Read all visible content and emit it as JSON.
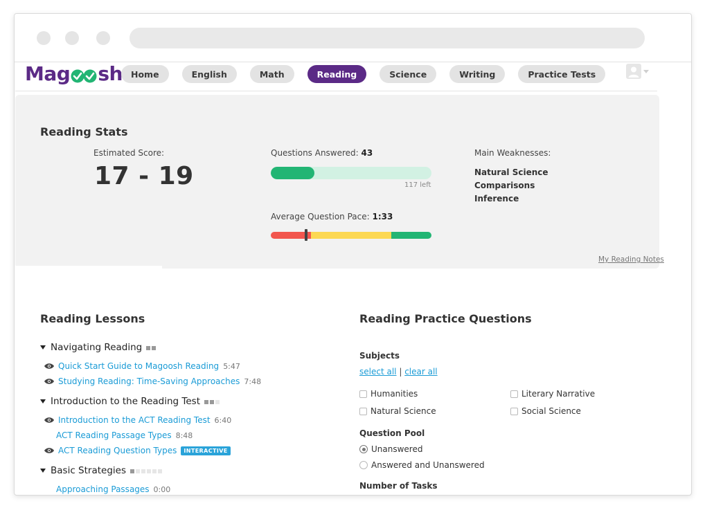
{
  "brand": {
    "logo_left": "Mag",
    "logo_right": "sh",
    "color_brand": "#5b2a86",
    "color_check": "#22b574"
  },
  "nav": {
    "items": [
      "Home",
      "English",
      "Math",
      "Reading",
      "Science",
      "Writing",
      "Practice Tests"
    ],
    "active": "Reading"
  },
  "stats": {
    "title": "Reading Stats",
    "estimated_label": "Estimated Score:",
    "score": "17 - 19",
    "answered_label": "Questions Answered:",
    "answered_value": "43",
    "answered_progress": 0.27,
    "left_text": "117 left",
    "pace_label": "Average Question Pace:",
    "pace_value": "1:33",
    "pace_colors": [
      "#f2564e",
      "#fcd853",
      "#22b574"
    ],
    "weak_label": "Main Weaknesses:",
    "weaknesses": [
      "Natural Science",
      "Comparisons",
      "Inference"
    ],
    "notes_link": "My Reading Notes"
  },
  "lessons": {
    "title": "Reading Lessons",
    "sections": [
      {
        "name": "Navigating Reading",
        "items": [
          {
            "title": "Quick Start Guide to Magoosh Reading",
            "duration": "5:47",
            "watched": true
          },
          {
            "title": "Studying Reading: Time-Saving Approaches",
            "duration": "7:48",
            "watched": true
          }
        ]
      },
      {
        "name": "Introduction to the Reading Test",
        "items": [
          {
            "title": "Introduction to the ACT Reading Test",
            "duration": "6:40",
            "watched": true
          },
          {
            "title": "ACT Reading Passage Types",
            "duration": "8:48",
            "watched": false
          },
          {
            "title": "ACT Reading Question Types",
            "badge": "INTERACTIVE",
            "watched": true
          }
        ]
      },
      {
        "name": "Basic Strategies",
        "items": [
          {
            "title": "Approaching Passages",
            "duration": "0:00",
            "watched": false
          }
        ]
      }
    ]
  },
  "practice": {
    "title": "Reading Practice Questions",
    "subjects_label": "Subjects",
    "select_all": "select all",
    "separator": "|",
    "clear_all": "clear all",
    "subjects": [
      "Humanities",
      "Literary Narrative",
      "Natural Science",
      "Social Science"
    ],
    "pool_label": "Question Pool",
    "pool_options": [
      "Unanswered",
      "Answered and Unanswered"
    ],
    "pool_selected": "Unanswered",
    "tasks_label": "Number of Tasks"
  }
}
